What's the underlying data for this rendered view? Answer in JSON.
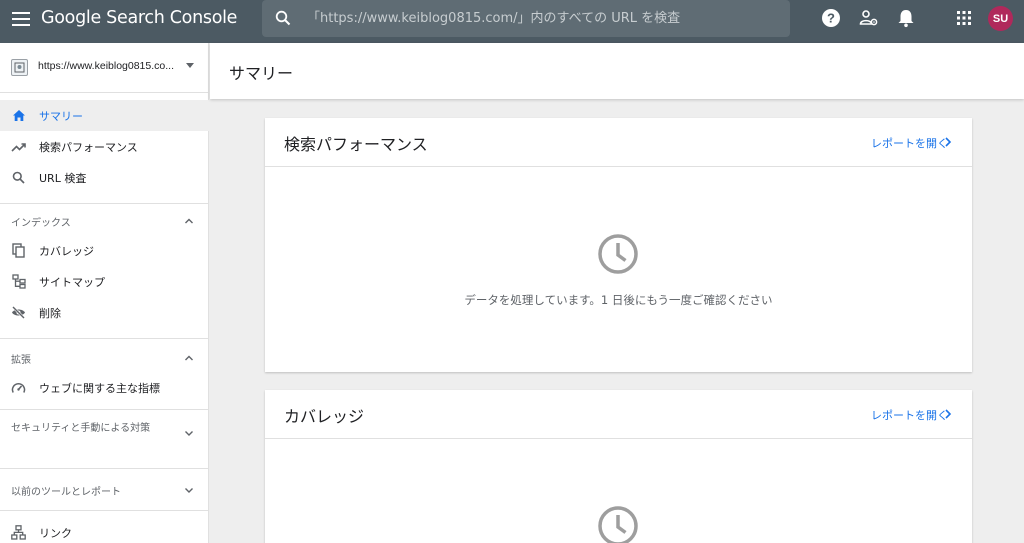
{
  "app": {
    "title": "Google Search Console"
  },
  "search": {
    "placeholder": "「https://www.keiblog0815.com/」内のすべての URL を検査"
  },
  "user": {
    "initials": "SU",
    "avatar_color": "#b0295b"
  },
  "colors": {
    "topbar": "#4c5a63",
    "accent": "#1a73e8"
  },
  "sidebar": {
    "property_url": "https://www.keiblog0815.co...",
    "items": [
      {
        "label": "サマリー",
        "icon": "home-icon",
        "active": true
      },
      {
        "label": "検索パフォーマンス",
        "icon": "trending-up-icon"
      },
      {
        "label": "URL 検査",
        "icon": "search-icon"
      }
    ],
    "sections": [
      {
        "label": "インデックス",
        "items": [
          {
            "label": "カバレッジ",
            "icon": "copy-icon"
          },
          {
            "label": "サイトマップ",
            "icon": "sitemap-icon"
          },
          {
            "label": "削除",
            "icon": "visibility-off-icon"
          }
        ]
      },
      {
        "label": "拡張",
        "items": [
          {
            "label": "ウェブに関する主な指標",
            "icon": "speed-gauge-icon"
          }
        ]
      },
      {
        "label": "セキュリティと手動による対策"
      },
      {
        "label": "以前のツールとレポート"
      }
    ],
    "bottom_item": {
      "label": "リンク",
      "icon": "links-icon"
    }
  },
  "main": {
    "page_title": "サマリー",
    "cards": [
      {
        "title": "検索パフォーマンス",
        "link": "レポートを開く",
        "message": "データを処理しています。1 日後にもう一度ご確認ください"
      },
      {
        "title": "カバレッジ",
        "link": "レポートを開く"
      }
    ]
  }
}
